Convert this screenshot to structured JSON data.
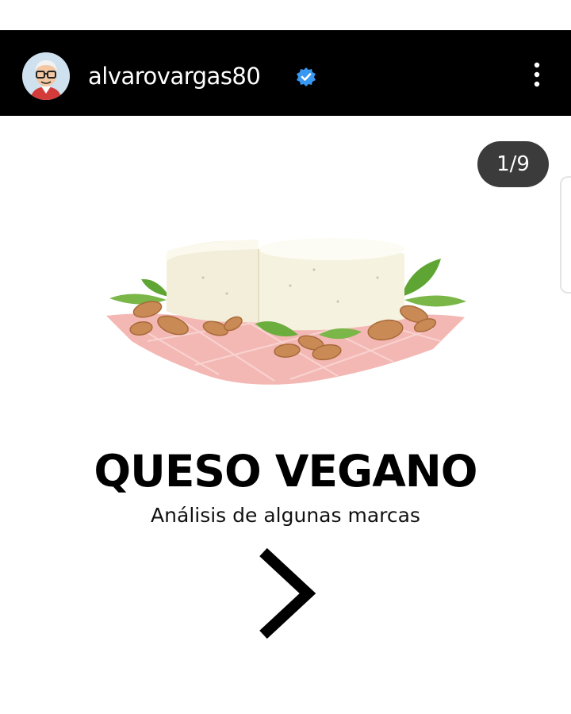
{
  "header": {
    "username": "alvarovargas80",
    "verified_icon": "verified-badge-icon",
    "menu_icon": "more-vertical-icon",
    "accent_color": "#3897f0"
  },
  "post": {
    "counter": "1/9",
    "illustration": "vegan-cheese-with-almonds-and-leaves",
    "title": "QUESO VEGANO",
    "subtitle": "Análisis de algunas marcas",
    "next_icon": "chevron-right-icon"
  }
}
